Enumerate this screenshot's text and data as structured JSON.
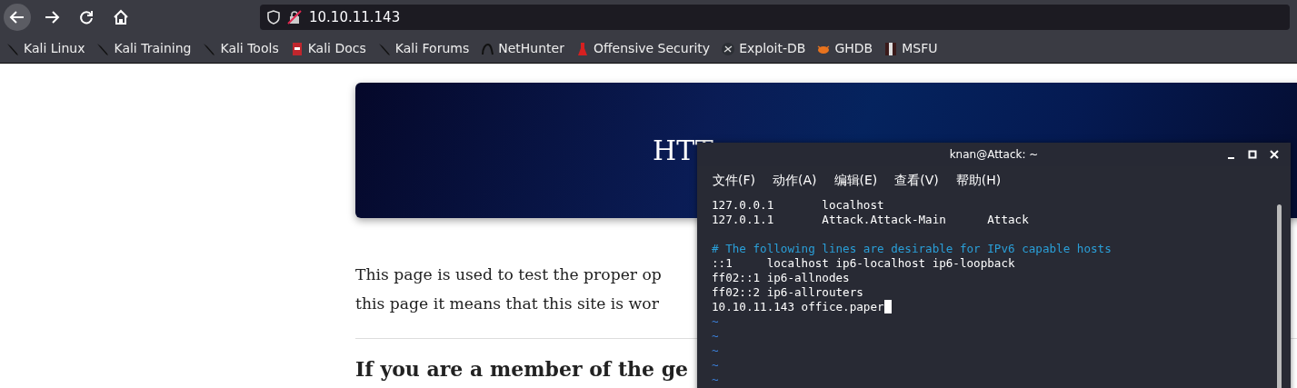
{
  "browser": {
    "address": "10.10.11.143",
    "bookmarks": [
      {
        "label": "Kali Linux",
        "kind": "kali"
      },
      {
        "label": "Kali Training",
        "kind": "kali"
      },
      {
        "label": "Kali Tools",
        "kind": "kali"
      },
      {
        "label": "Kali Docs",
        "kind": "docs"
      },
      {
        "label": "Kali Forums",
        "kind": "kali"
      },
      {
        "label": "NetHunter",
        "kind": "nethunter"
      },
      {
        "label": "Offensive Security",
        "kind": "offsec"
      },
      {
        "label": "Exploit-DB",
        "kind": "exploitdb"
      },
      {
        "label": "GHDB",
        "kind": "ghdb"
      },
      {
        "label": "MSFU",
        "kind": "msfu"
      }
    ]
  },
  "page": {
    "banner_title": "HTT",
    "paragraph_lines": [
      "This page is used to test the proper op",
      "this page it means that this site is wor"
    ],
    "headings": [
      "If you are a member of the ge"
    ]
  },
  "terminal": {
    "title": "knan@Attack: ~",
    "menu": [
      "文件(F)",
      "动作(A)",
      "编辑(E)",
      "查看(V)",
      "帮助(H)"
    ],
    "lines": [
      {
        "kind": "text",
        "text": "127.0.0.1       localhost"
      },
      {
        "kind": "text",
        "text": "127.0.1.1       Attack.Attack-Main      Attack"
      },
      {
        "kind": "blank"
      },
      {
        "kind": "comment",
        "text": "# The following lines are desirable for IPv6 capable hosts"
      },
      {
        "kind": "text",
        "text": "::1     localhost ip6-localhost ip6-loopback"
      },
      {
        "kind": "text",
        "text": "ff02::1 ip6-allnodes"
      },
      {
        "kind": "text",
        "text": "ff02::2 ip6-allrouters"
      },
      {
        "kind": "text",
        "text": "10.10.11.143 office.paper",
        "cursor": true
      },
      {
        "kind": "tilde",
        "text": "~"
      },
      {
        "kind": "tilde",
        "text": "~"
      },
      {
        "kind": "tilde",
        "text": "~"
      },
      {
        "kind": "tilde",
        "text": "~"
      },
      {
        "kind": "tilde",
        "text": "~"
      }
    ]
  }
}
